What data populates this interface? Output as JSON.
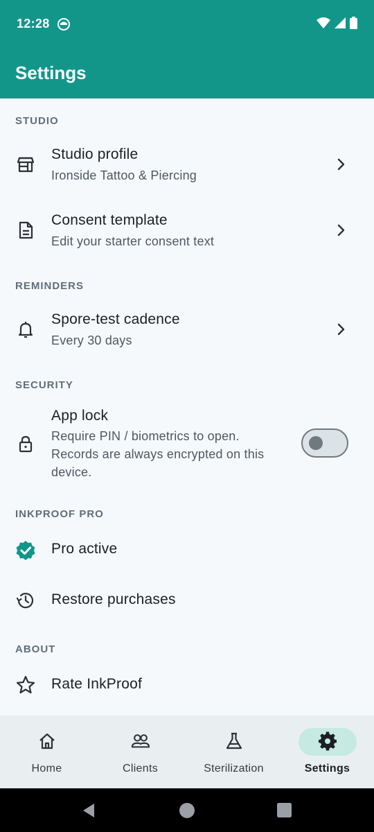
{
  "status_bar": {
    "time": "12:28"
  },
  "app_bar": {
    "title": "Settings"
  },
  "sections": {
    "studio": "STUDIO",
    "reminders": "REMINDERS",
    "security": "SECURITY",
    "pro": "INKPROOF PRO",
    "about": "ABOUT"
  },
  "rows": {
    "studio_profile": {
      "title": "Studio profile",
      "subtitle": "Ironside Tattoo & Piercing"
    },
    "consent_template": {
      "title": "Consent template",
      "subtitle": "Edit your starter consent text"
    },
    "spore_test": {
      "title": "Spore-test cadence",
      "subtitle": "Every 30 days"
    },
    "app_lock": {
      "title": "App lock",
      "subtitle_line1": "Require PIN / biometrics to open.",
      "subtitle_line2": "Records are always encrypted on this",
      "subtitle_line3": "device.",
      "enabled": false
    },
    "pro_active": {
      "title": "Pro active"
    },
    "restore": {
      "title": "Restore purchases"
    },
    "rate": {
      "title": "Rate InkProof"
    }
  },
  "bottom_nav": {
    "items": [
      {
        "label": "Home",
        "icon": "home-icon"
      },
      {
        "label": "Clients",
        "icon": "people-icon"
      },
      {
        "label": "Sterilization",
        "icon": "flask-icon"
      },
      {
        "label": "Settings",
        "icon": "gear-icon",
        "active": true
      }
    ]
  },
  "colors": {
    "primary": "#12968a",
    "background": "#f6f9fb",
    "nav_background": "#e9eff0",
    "active_pill": "#c6e9e1"
  }
}
